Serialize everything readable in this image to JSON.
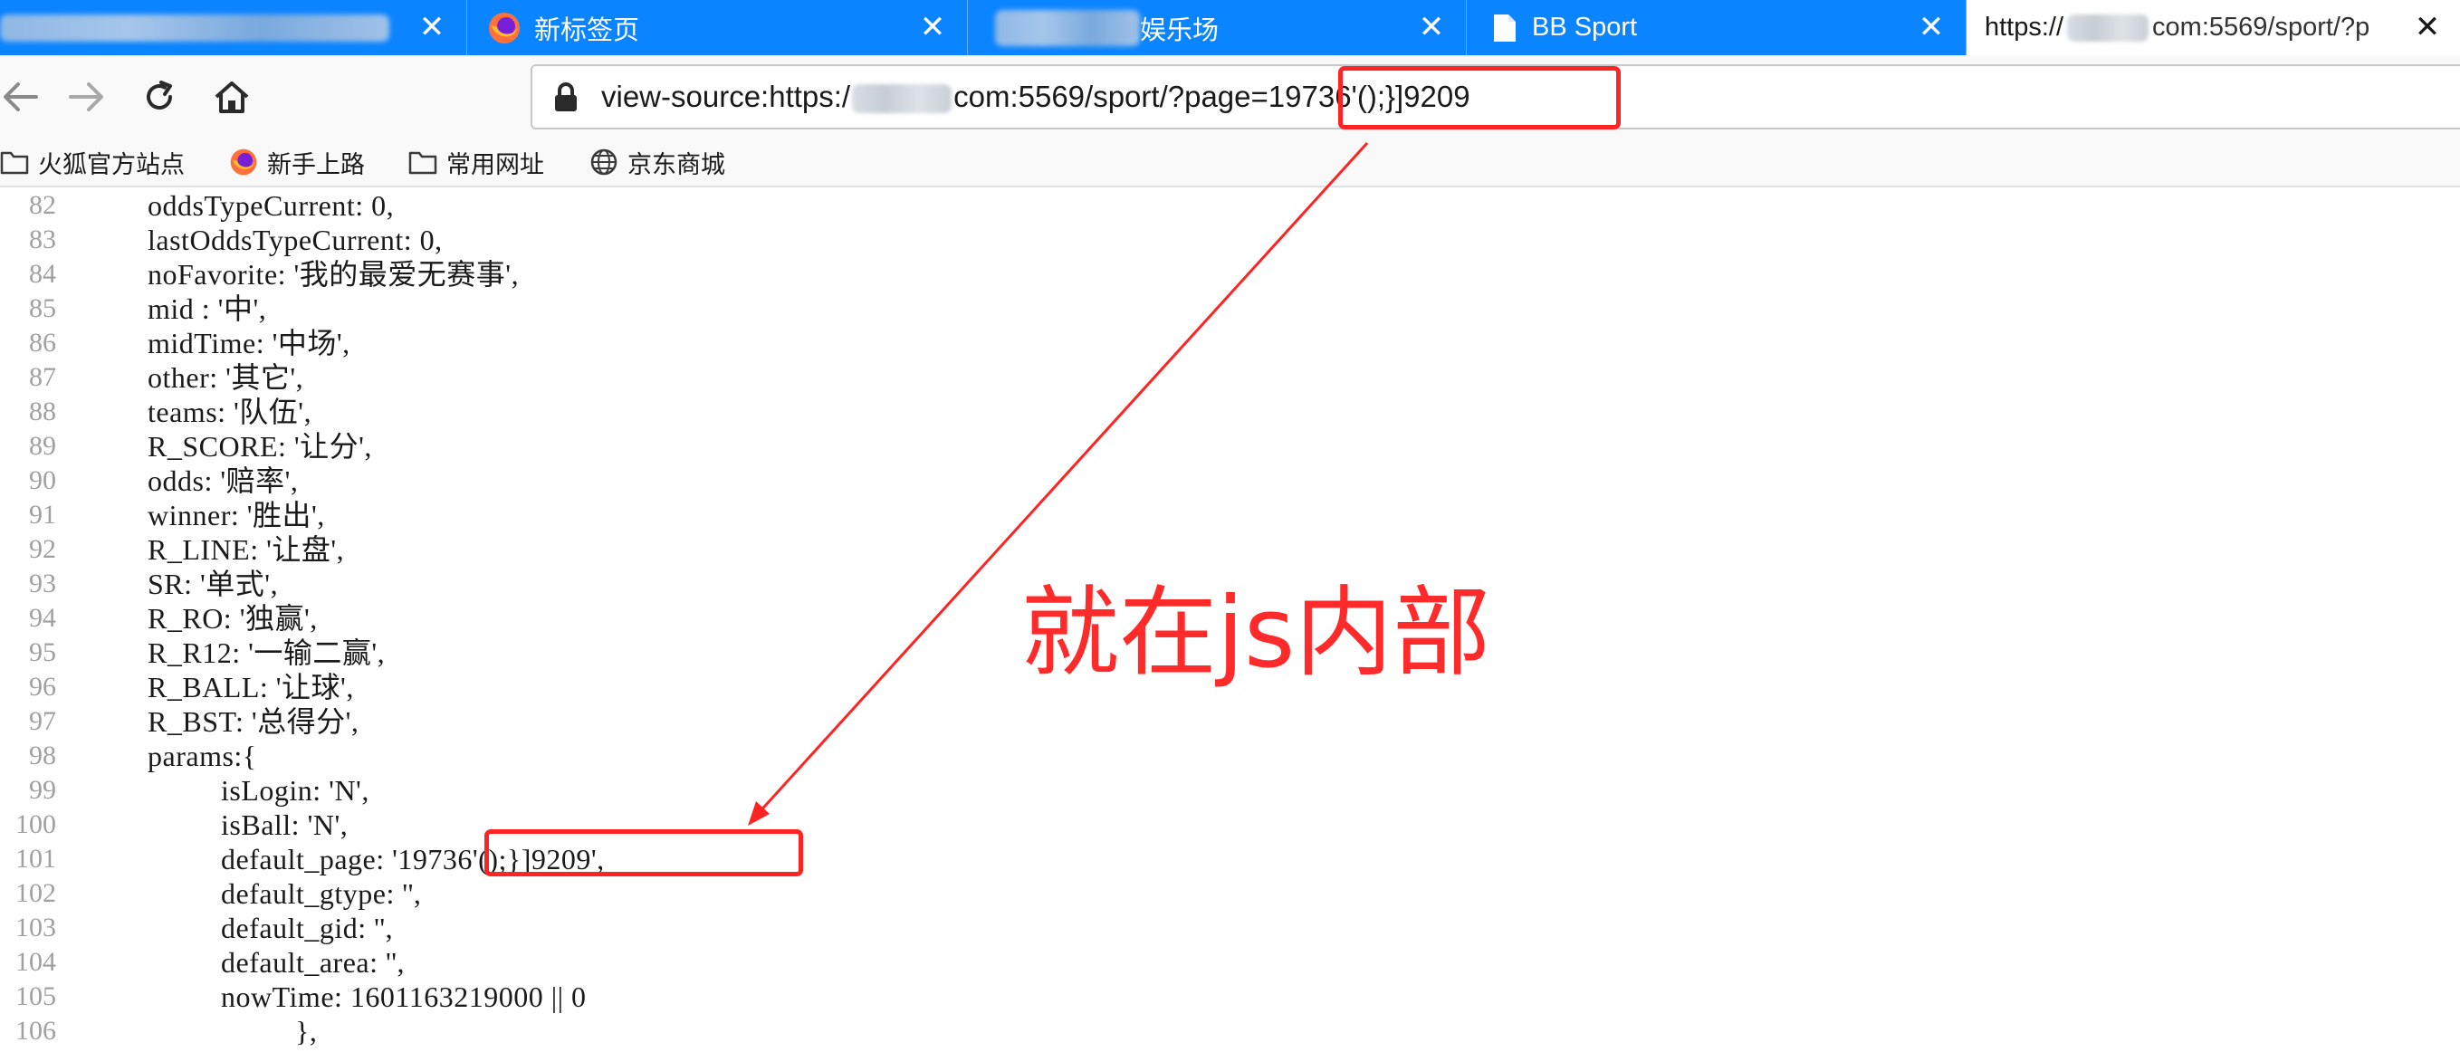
{
  "tabs": [
    {
      "title": "",
      "blurred_title": true,
      "close": "✕"
    },
    {
      "title": "新标签页",
      "icon": "firefox-icon",
      "close": "✕"
    },
    {
      "title": "娱乐场",
      "blurred_prefix": true,
      "close": "✕"
    },
    {
      "title": "BB Sport",
      "icon": "page-icon",
      "close": "✕"
    },
    {
      "title_prefix": "https://",
      "title_suffix": "com:5569/sport/?p",
      "active": true,
      "close": "✕"
    }
  ],
  "nav": {
    "url_prefix": "view-source:https:/",
    "url_middle": "com:5569/sport/?page=",
    "url_payload": "19736'();}]9209"
  },
  "bookmarks": [
    {
      "label": "火狐官方站点",
      "icon": "folder-icon"
    },
    {
      "label": "新手上路",
      "icon": "firefox-icon"
    },
    {
      "label": "常用网址",
      "icon": "folder-icon"
    },
    {
      "label": "京东商城",
      "icon": "globe-icon"
    }
  ],
  "source_lines": [
    {
      "n": "82",
      "indent": 1,
      "text": "oddsTypeCurrent: 0,"
    },
    {
      "n": "83",
      "indent": 1,
      "text": "lastOddsTypeCurrent: 0,"
    },
    {
      "n": "84",
      "indent": 1,
      "text": "noFavorite: '我的最爱无赛事',"
    },
    {
      "n": "85",
      "indent": 1,
      "text": "mid : '中',"
    },
    {
      "n": "86",
      "indent": 1,
      "text": "midTime: '中场',"
    },
    {
      "n": "87",
      "indent": 1,
      "text": "other: '其它',"
    },
    {
      "n": "88",
      "indent": 1,
      "text": "teams: '队伍',"
    },
    {
      "n": "89",
      "indent": 1,
      "text": "R_SCORE: '让分',"
    },
    {
      "n": "90",
      "indent": 1,
      "text": "odds: '赔率',"
    },
    {
      "n": "91",
      "indent": 1,
      "text": "winner: '胜出',"
    },
    {
      "n": "92",
      "indent": 1,
      "text": "R_LINE: '让盘',"
    },
    {
      "n": "93",
      "indent": 1,
      "text": "SR: '单式',"
    },
    {
      "n": "94",
      "indent": 1,
      "text": "R_RO: '独赢',"
    },
    {
      "n": "95",
      "indent": 1,
      "text": "R_R12: '一输二赢',"
    },
    {
      "n": "96",
      "indent": 1,
      "text": "R_BALL: '让球',"
    },
    {
      "n": "97",
      "indent": 1,
      "text": "R_BST: '总得分',"
    },
    {
      "n": "98",
      "indent": 1,
      "text": "params:{"
    },
    {
      "n": "99",
      "indent": 2,
      "text": "isLogin: 'N',"
    },
    {
      "n": "100",
      "indent": 2,
      "text": "isBall: 'N',"
    },
    {
      "n": "101",
      "indent": 2,
      "text": "default_page: '19736'();}]9209',"
    },
    {
      "n": "102",
      "indent": 2,
      "text": "default_gtype: '',"
    },
    {
      "n": "103",
      "indent": 2,
      "text": "default_gid: '',"
    },
    {
      "n": "104",
      "indent": 2,
      "text": "default_area: '',"
    },
    {
      "n": "105",
      "indent": 2,
      "text": "nowTime: 1601163219000 || 0"
    },
    {
      "n": "106",
      "indent": 3,
      "text": "},"
    }
  ],
  "annotation": {
    "label": "就在js内部",
    "color": "#ff2323"
  },
  "colors": {
    "tabstrip": "#0a84ff",
    "annotation_red": "#ff2323",
    "line_number_gray": "#a0a0a0"
  }
}
